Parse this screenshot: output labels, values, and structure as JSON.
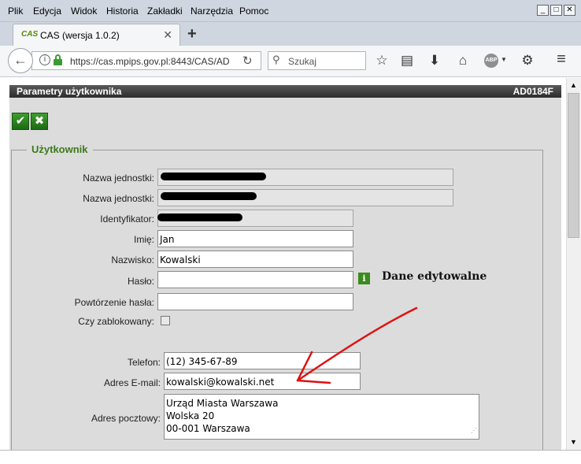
{
  "window": {
    "menu": [
      "Plik",
      "Edycja",
      "Widok",
      "Historia",
      "Zakładki",
      "Narzędzia",
      "Pomoc"
    ],
    "controls": {
      "minimize": "_",
      "maximize": "□",
      "close": "✕"
    }
  },
  "tab": {
    "favicon_text": "CAS",
    "title": "CAS (wersja 1.0.2)",
    "close": "✕",
    "new_tab": "+"
  },
  "navbar": {
    "back": "←",
    "info": "i",
    "url": "https://cas.mpips.gov.pl:8443/CAS/AD",
    "reload": "↻",
    "search_icon": "⚲",
    "search_placeholder": "Szukaj",
    "icons": {
      "bookmark_star": "☆",
      "reading_list": "▤",
      "download": "⬇",
      "home": "⌂",
      "abp": "ABP",
      "abp_arrow": "▼",
      "extension": "⚙",
      "menu": "≡"
    }
  },
  "page": {
    "header_title": "Parametry użytkownika",
    "header_code": "AD0184F",
    "ok_glyph": "✔",
    "cancel_glyph": "✖",
    "section_title": "Użytkownik",
    "fields": {
      "unit_name_1_label": "Nazwa jednostki:",
      "unit_name_2_label": "Nazwa jednostki:",
      "identifier_label": "Identyfikator:",
      "first_name_label": "Imię:",
      "first_name_value": "Jan",
      "last_name_label": "Nazwisko:",
      "last_name_value": "Kowalski",
      "password_label": "Hasło:",
      "password_value": "",
      "password_repeat_label": "Powtórzenie hasła:",
      "password_repeat_value": "",
      "blocked_label": "Czy zablokowany:",
      "phone_label": "Telefon:",
      "phone_value": "(12) 345-67-89",
      "email_label": "Adres E-mail:",
      "email_value": "kowalski@kowalski.net",
      "postal_label": "Adres pocztowy:",
      "postal_lines": [
        "Urząd Miasta Warszawa",
        "Wolska 20",
        "00-001 Warszawa"
      ]
    },
    "info_glyph": "i",
    "annotation": "Dane edytowalne",
    "annotation_arrow_color": "#e01010"
  },
  "scrollbar": {
    "up": "▲",
    "down": "▼"
  }
}
